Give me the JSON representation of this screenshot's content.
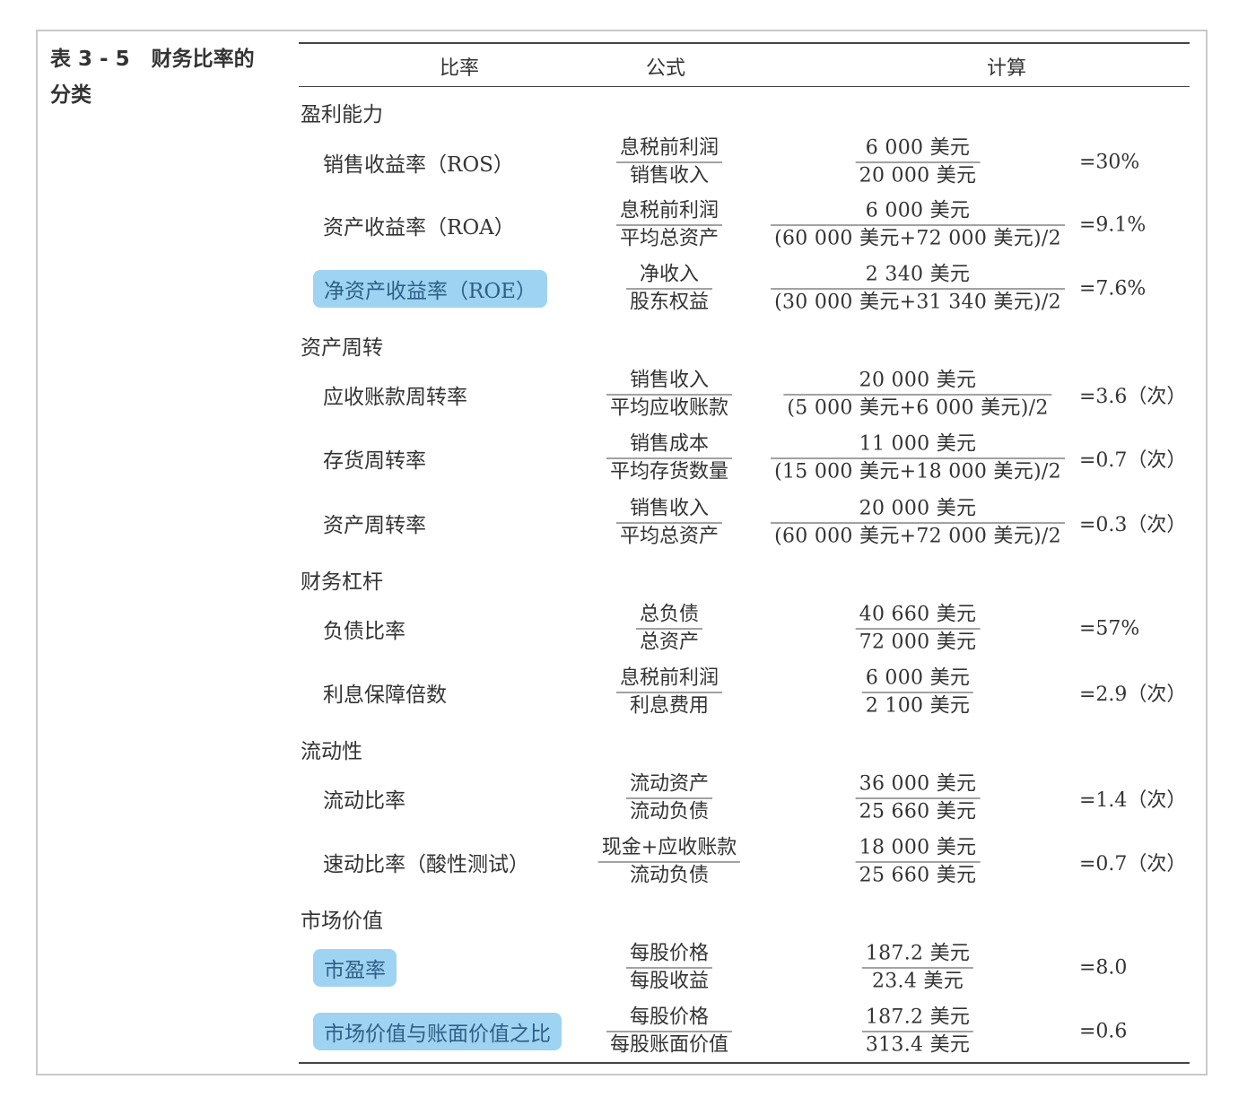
{
  "caption": {
    "label": "表 3 - 5",
    "title_line1": "财务比率的",
    "title_line2": "分类"
  },
  "headers": {
    "ratio": "比率",
    "formula": "公式",
    "calc": "计算"
  },
  "sections": [
    {
      "title": "盈利能力",
      "rows": [
        {
          "name": "销售收益率（ROS）",
          "highlight": false,
          "formula_num": "息税前利润",
          "formula_den": "销售收入",
          "calc_num": "6 000 美元",
          "calc_den": "20 000 美元",
          "result": "=30%"
        },
        {
          "name": "资产收益率（ROA）",
          "highlight": false,
          "formula_num": "息税前利润",
          "formula_den": "平均总资产",
          "calc_num": "6 000 美元",
          "calc_den": "(60 000 美元+72 000 美元)/2",
          "result": "=9.1%"
        },
        {
          "name": "净资产收益率（ROE）",
          "highlight": true,
          "formula_num": "净收入",
          "formula_den": "股东权益",
          "calc_num": "2 340 美元",
          "calc_den": "(30 000 美元+31 340 美元)/2",
          "result": "=7.6%"
        }
      ]
    },
    {
      "title": "资产周转",
      "rows": [
        {
          "name": "应收账款周转率",
          "highlight": false,
          "formula_num": "销售收入",
          "formula_den": "平均应收账款",
          "calc_num": "20 000 美元",
          "calc_den": "(5 000 美元+6 000 美元)/2",
          "result": "=3.6（次）"
        },
        {
          "name": "存货周转率",
          "highlight": false,
          "formula_num": "销售成本",
          "formula_den": "平均存货数量",
          "calc_num": "11 000 美元",
          "calc_den": "(15 000 美元+18 000 美元)/2",
          "result": "=0.7（次）"
        },
        {
          "name": "资产周转率",
          "highlight": false,
          "formula_num": "销售收入",
          "formula_den": "平均总资产",
          "calc_num": "20 000 美元",
          "calc_den": "(60 000 美元+72 000 美元)/2",
          "result": "=0.3（次）"
        }
      ]
    },
    {
      "title": "财务杠杆",
      "rows": [
        {
          "name": "负债比率",
          "highlight": false,
          "formula_num": "总负债",
          "formula_den": "总资产",
          "calc_num": "40 660 美元",
          "calc_den": "72 000 美元",
          "result": "=57%"
        },
        {
          "name": "利息保障倍数",
          "highlight": false,
          "formula_num": "息税前利润",
          "formula_den": "利息费用",
          "calc_num": "6 000 美元",
          "calc_den": "2 100 美元",
          "result": "=2.9（次）"
        }
      ]
    },
    {
      "title": "流动性",
      "rows": [
        {
          "name": "流动比率",
          "highlight": false,
          "formula_num": "流动资产",
          "formula_den": "流动负债",
          "calc_num": "36 000 美元",
          "calc_den": "25 660 美元",
          "result": "=1.4（次）"
        },
        {
          "name": "速动比率（酸性测试）",
          "highlight": false,
          "formula_num": "现金+应收账款",
          "formula_den": "流动负债",
          "calc_num": "18 000 美元",
          "calc_den": "25 660 美元",
          "result": "=0.7（次）"
        }
      ]
    },
    {
      "title": "市场价值",
      "rows": [
        {
          "name": "市盈率",
          "highlight": true,
          "formula_num": "每股价格",
          "formula_den": "每股收益",
          "calc_num": "187.2 美元",
          "calc_den": "23.4 美元",
          "result": "=8.0"
        },
        {
          "name": "市场价值与账面价值之比",
          "highlight": true,
          "formula_num": "每股价格",
          "formula_den": "每股账面价值",
          "calc_num": "187.2 美元",
          "calc_den": "313.4 美元",
          "result": "=0.6"
        }
      ]
    }
  ]
}
